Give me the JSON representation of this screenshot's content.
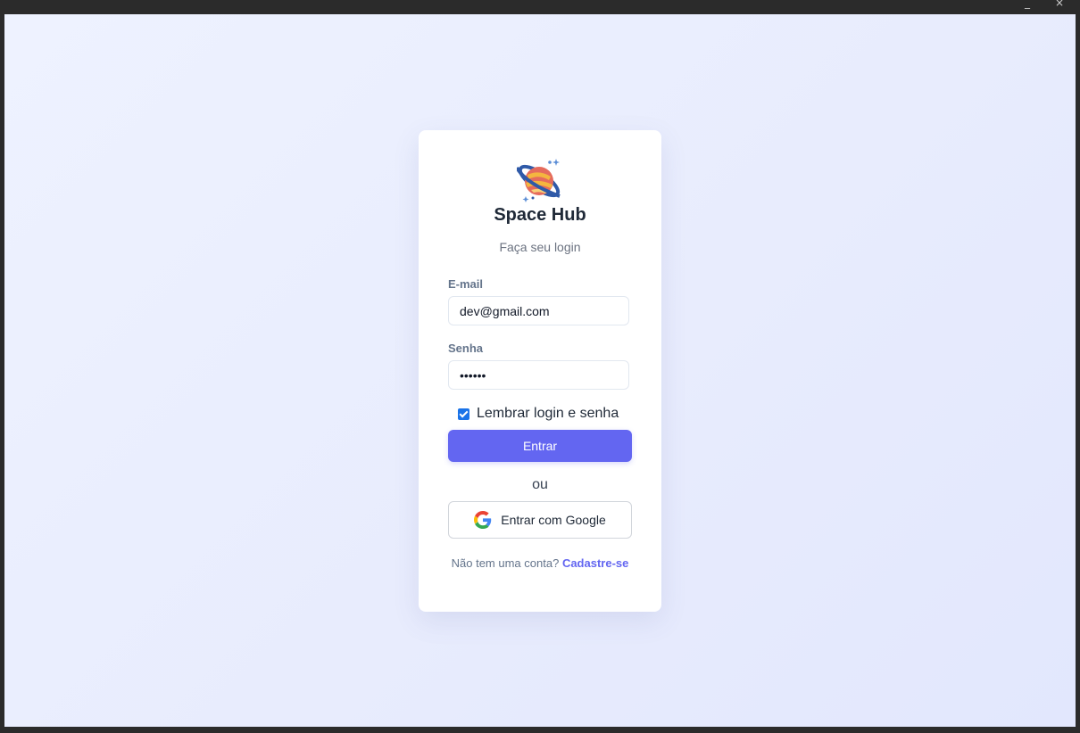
{
  "app": {
    "title": "Space Hub",
    "subtitle": "Faça seu login"
  },
  "form": {
    "email_label": "E-mail",
    "email_value": "dev@gmail.com",
    "password_label": "Senha",
    "password_mask": "••••••",
    "remember_label": "Lembrar login e senha",
    "remember_checked": true,
    "submit_label": "Entrar",
    "or_text": "ou",
    "google_label": "Entrar com Google",
    "signup_prompt": "Não tem uma conta?",
    "signup_link": "Cadastre-se"
  },
  "icons": {
    "logo": "planet-logo-icon",
    "google": "google-icon"
  },
  "colors": {
    "accent": "#6366f1",
    "background": "#eef2ff",
    "card": "#ffffff"
  }
}
